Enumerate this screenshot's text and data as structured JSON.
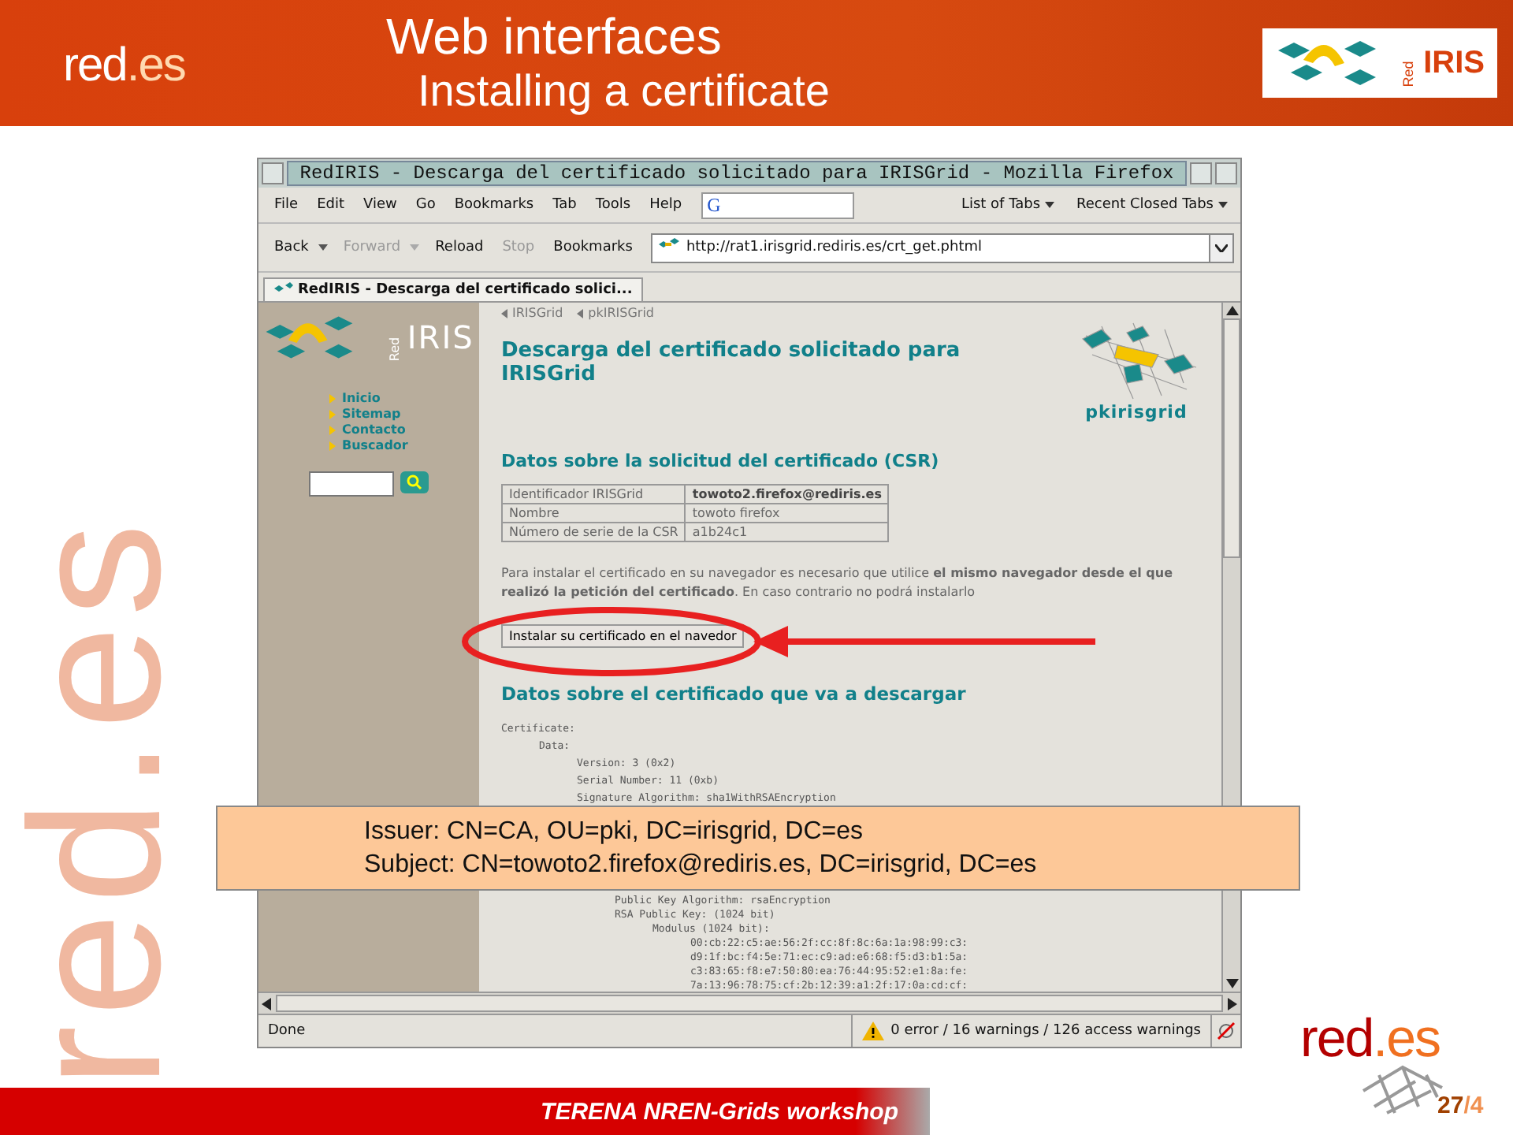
{
  "slide_header": {
    "title": "Web interfaces",
    "subtitle": "Installing a certificate",
    "logo_main": "red",
    "logo_suffix": ".es",
    "partner_logo_top": "Red",
    "partner_logo_main": "IRIS"
  },
  "side_mark": {
    "main": "red",
    "suffix": ".es"
  },
  "browser": {
    "title": "RedIRIS - Descarga del certificado solicitado para IRISGrid - Mozilla Firefox",
    "search_engine": "G",
    "menus": [
      "File",
      "Edit",
      "View",
      "Go",
      "Bookmarks",
      "Tab",
      "Tools",
      "Help"
    ],
    "tab_menus": [
      "List of Tabs",
      "Recent Closed Tabs"
    ],
    "nav": [
      {
        "label": "Back",
        "disabled": false,
        "dropdown": true
      },
      {
        "label": "Forward",
        "disabled": true,
        "dropdown": true
      },
      {
        "label": "Reload",
        "disabled": false,
        "dropdown": false
      },
      {
        "label": "Stop",
        "disabled": true,
        "dropdown": false
      },
      {
        "label": "Bookmarks",
        "disabled": false,
        "dropdown": false
      }
    ],
    "url": "http://rat1.irisgrid.rediris.es/crt_get.phtml",
    "tabs": [
      {
        "label": "RedIRIS - Descarga del certificado solici...",
        "selected": true
      }
    ],
    "status": "Done",
    "warnings": "0 error / 16 warnings / 126 access warnings"
  },
  "page": {
    "sidebar": {
      "logo_top": "Red",
      "logo_main": "IRIS",
      "links": [
        "Inicio",
        "Sitemap",
        "Contacto",
        "Buscador"
      ]
    },
    "breadcrumbs": [
      "IRISGrid",
      "pkIRISGrid"
    ],
    "heading": "Descarga del certificado solicitado para IRISGrid",
    "pki_logo": "pkirisgrid",
    "section_csr": "Datos sobre la solicitud del certificado (CSR)",
    "csr_rows": [
      {
        "label": "Identificador IRISGrid",
        "value": "towoto2.firefox@rediris.es",
        "emphasis": true
      },
      {
        "label": "Nombre",
        "value": "towoto firefox",
        "emphasis": false
      },
      {
        "label": "Número de serie de la CSR",
        "value": "a1b24c1",
        "emphasis": false
      }
    ],
    "notice": "Para instalar el certificado en su navegador es necesario que utilice **el mismo navegador desde el que realizó la petición del certificado**. En caso contrario no podrá instalarlo",
    "install_button": "Instalar su certificado en el navedor",
    "section_cert": "Datos sobre el certificado que va a descargar",
    "certificate": [
      {
        "text": "Certificate:",
        "children": [
          {
            "text": "Data:",
            "children": [
              {
                "text": "Version: 3 (0x2)"
              },
              {
                "text": "Serial Number: 11 (0xb)"
              },
              {
                "text": "Signature Algorithm: sha1WithRSAEncryption"
              }
            ]
          }
        ]
      }
    ],
    "certificate_continued": [
      {
        "text": "Public Key Algorithm: rsaEncryption"
      },
      {
        "text": "RSA Public Key: (1024 bit)",
        "children": [
          {
            "text": "Modulus (1024 bit):",
            "children": [
              {
                "text": "00:cb:22:c5:ae:56:2f:cc:8f:8c:6a:1a:98:99:c3:"
              },
              {
                "text": "d9:1f:bc:f4:5e:71:ec:c9:ad:e6:68:f5:d3:b1:5a:"
              },
              {
                "text": "c3:83:65:f8:e7:50:80:ea:76:44:95:52:e1:8a:fe:"
              },
              {
                "text": "7a:13:96:78:75:cf:2b:12:39:a1:2f:17:0a:cd:cf:"
              }
            ]
          }
        ]
      }
    ]
  },
  "callout": [
    "Issuer: CN=CA, OU=pki, DC=irisgrid, DC=es",
    "Subject: CN=towoto2.firefox@rediris.es, DC=irisgrid, DC=es"
  ],
  "footer": {
    "event": "TERENA NREN-Grids workshop",
    "page": "27",
    "total": "/4",
    "logo_main": "red",
    "logo_suffix": ".es"
  }
}
